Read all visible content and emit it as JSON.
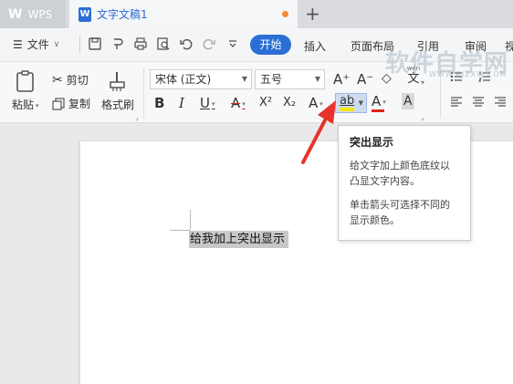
{
  "titlebar": {
    "app_name": "WPS",
    "document_tab": "文字文稿1",
    "new_tab_label": "+"
  },
  "menubar": {
    "file_label": "文件",
    "tabs": [
      "开始",
      "插入",
      "页面布局",
      "引用",
      "审阅",
      "视"
    ]
  },
  "ribbon": {
    "paste_label": "粘贴",
    "cut_label": "剪切",
    "copy_label": "复制",
    "format_painter_label": "格式刷",
    "font_name": "宋体 (正文)",
    "font_size": "五号",
    "bold": "B",
    "italic": "I",
    "underline": "U",
    "strikethrough": "A",
    "superscript": "X²",
    "subscript": "X₂",
    "text_effect": "A",
    "highlight": "ab",
    "font_color": "A",
    "char_shading": "A",
    "grow_font": "A⁺",
    "shrink_font": "A⁻",
    "clear_format": "◇",
    "phonetic": "wén",
    "phonetic_char": "文"
  },
  "document": {
    "text": "给我加上突出显示"
  },
  "tooltip": {
    "title": "突出显示",
    "line1": "给文字加上颜色底纹以凸显文字内容。",
    "line2": "单击箭头可选择不同的显示颜色。"
  },
  "watermark": {
    "text": "软件自学网",
    "sub": "WWW.RJZXW.COM"
  },
  "colors": {
    "accent": "#2b6fd6",
    "highlight_yellow": "#f5e600",
    "font_color_red": "#e2231a",
    "arrow_red": "#e8322c",
    "selection_gray": "#c8c8c8"
  }
}
